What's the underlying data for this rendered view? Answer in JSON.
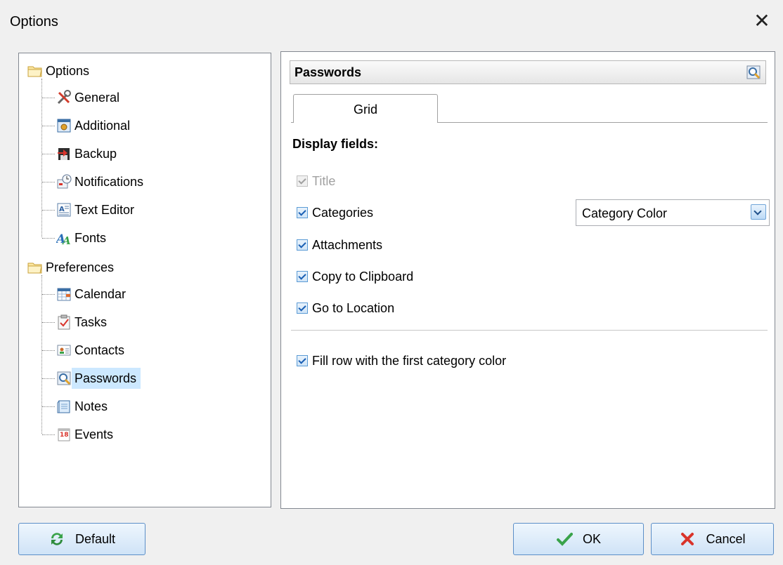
{
  "window": {
    "title": "Options",
    "close_glyph": "✕"
  },
  "tree": {
    "groups": [
      {
        "label": "Options",
        "icon": "folder-icon",
        "items": [
          {
            "label": "General",
            "icon": "tools-icon"
          },
          {
            "label": "Additional",
            "icon": "additional-settings-icon"
          },
          {
            "label": "Backup",
            "icon": "backup-icon"
          },
          {
            "label": "Notifications",
            "icon": "notifications-icon"
          },
          {
            "label": "Text Editor",
            "icon": "text-editor-icon"
          },
          {
            "label": "Fonts",
            "icon": "fonts-icon"
          }
        ]
      },
      {
        "label": "Preferences",
        "icon": "folder-icon",
        "items": [
          {
            "label": "Calendar",
            "icon": "calendar-icon"
          },
          {
            "label": "Tasks",
            "icon": "tasks-icon"
          },
          {
            "label": "Contacts",
            "icon": "contacts-icon"
          },
          {
            "label": "Passwords",
            "icon": "passwords-icon",
            "selected": true
          },
          {
            "label": "Notes",
            "icon": "notes-icon"
          },
          {
            "label": "Events",
            "icon": "events-icon",
            "badge": "18"
          }
        ]
      }
    ]
  },
  "panel": {
    "title": "Passwords",
    "title_icon": "passwords-icon",
    "tab": "Grid",
    "section_label": "Display fields:",
    "fields": [
      {
        "label": "Title",
        "checked": true,
        "disabled": true
      },
      {
        "label": "Categories",
        "checked": true,
        "disabled": false
      },
      {
        "label": "Attachments",
        "checked": true,
        "disabled": false
      },
      {
        "label": "Copy to Clipboard",
        "checked": true,
        "disabled": false
      },
      {
        "label": "Go to Location",
        "checked": true,
        "disabled": false
      }
    ],
    "category_select": "Category Color",
    "fill_row": {
      "label": "Fill row with the first category color",
      "checked": true
    }
  },
  "buttons": {
    "default_label": "Default",
    "ok_label": "OK",
    "cancel_label": "Cancel"
  },
  "colors": {
    "selection": "#cce8ff",
    "accent": "#5c8fc8"
  }
}
